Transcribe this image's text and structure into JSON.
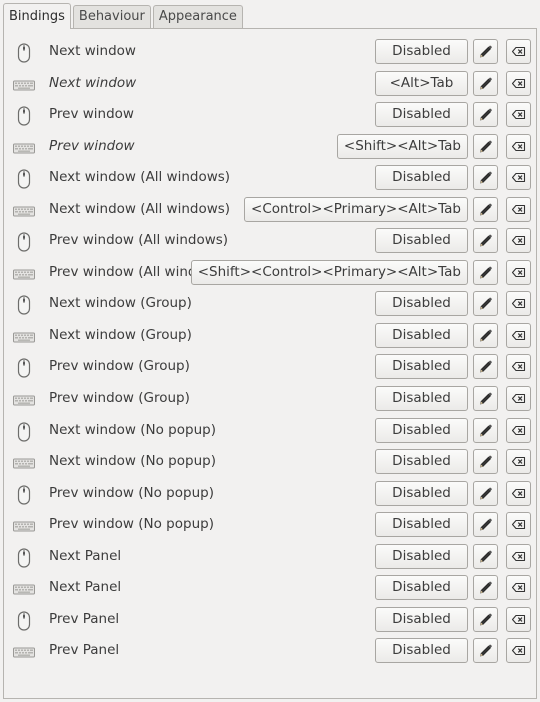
{
  "tabs": [
    {
      "label": "Bindings",
      "active": true
    },
    {
      "label": "Behaviour",
      "active": false
    },
    {
      "label": "Appearance",
      "active": false
    }
  ],
  "bindings": [
    {
      "device": "mouse-icon",
      "label": "Next window",
      "italic": false,
      "key": "Disabled"
    },
    {
      "device": "keyboard-icon",
      "label": "Next window",
      "italic": true,
      "key": "<Alt>Tab"
    },
    {
      "device": "mouse-icon",
      "label": "Prev window",
      "italic": false,
      "key": "Disabled"
    },
    {
      "device": "keyboard-icon",
      "label": "Prev window",
      "italic": true,
      "key": "<Shift><Alt>Tab"
    },
    {
      "device": "mouse-icon",
      "label": "Next window (All windows)",
      "italic": false,
      "key": "Disabled"
    },
    {
      "device": "keyboard-icon",
      "label": "Next window (All windows)",
      "italic": false,
      "key": "<Control><Primary><Alt>Tab"
    },
    {
      "device": "mouse-icon",
      "label": "Prev window (All windows)",
      "italic": false,
      "key": "Disabled"
    },
    {
      "device": "keyboard-icon",
      "label": "Prev window (All windows)",
      "italic": false,
      "key": "<Shift><Control><Primary><Alt>Tab"
    },
    {
      "device": "mouse-icon",
      "label": "Next window (Group)",
      "italic": false,
      "key": "Disabled"
    },
    {
      "device": "keyboard-icon",
      "label": "Next window (Group)",
      "italic": false,
      "key": "Disabled"
    },
    {
      "device": "mouse-icon",
      "label": "Prev window (Group)",
      "italic": false,
      "key": "Disabled"
    },
    {
      "device": "keyboard-icon",
      "label": "Prev window (Group)",
      "italic": false,
      "key": "Disabled"
    },
    {
      "device": "mouse-icon",
      "label": "Next window (No popup)",
      "italic": false,
      "key": "Disabled"
    },
    {
      "device": "keyboard-icon",
      "label": "Next window (No popup)",
      "italic": false,
      "key": "Disabled"
    },
    {
      "device": "mouse-icon",
      "label": "Prev window (No popup)",
      "italic": false,
      "key": "Disabled"
    },
    {
      "device": "keyboard-icon",
      "label": "Prev window (No popup)",
      "italic": false,
      "key": "Disabled"
    },
    {
      "device": "mouse-icon",
      "label": "Next Panel",
      "italic": false,
      "key": "Disabled"
    },
    {
      "device": "keyboard-icon",
      "label": "Next Panel",
      "italic": false,
      "key": "Disabled"
    },
    {
      "device": "mouse-icon",
      "label": "Prev Panel",
      "italic": false,
      "key": "Disabled"
    },
    {
      "device": "keyboard-icon",
      "label": "Prev Panel",
      "italic": false,
      "key": "Disabled"
    }
  ],
  "icons": {
    "edit": "pencil-icon",
    "clear": "clear-icon"
  }
}
